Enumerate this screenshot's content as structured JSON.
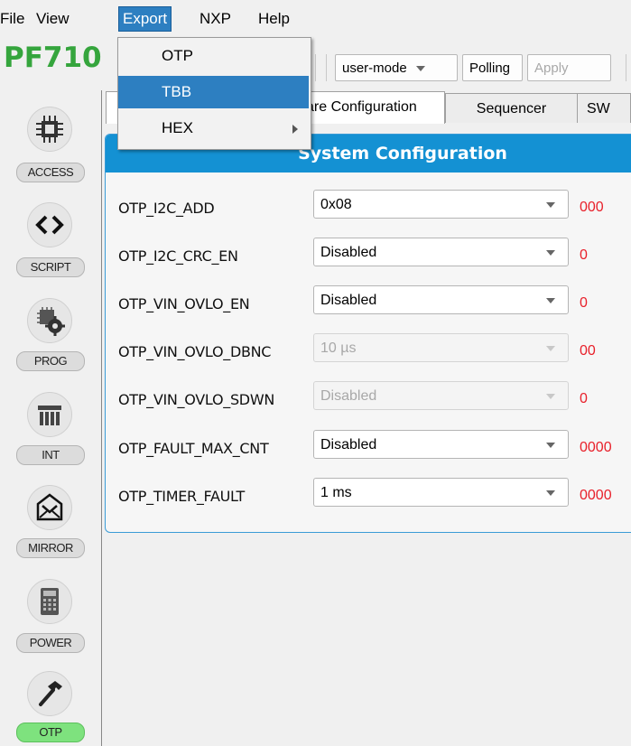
{
  "menubar": {
    "items": [
      "File",
      "View",
      "Export",
      "NXP",
      "Help"
    ]
  },
  "toolbar": {
    "brand": "PF710",
    "mode_combo": "user-mode",
    "polling_label": "Polling",
    "apply_label": "Apply"
  },
  "export_menu": {
    "items": [
      {
        "label": "OTP"
      },
      {
        "label": "TBB"
      },
      {
        "label": "HEX"
      }
    ]
  },
  "sidebar": {
    "items": [
      {
        "label": "ACCESS",
        "icon": "chip-icon"
      },
      {
        "label": "SCRIPT",
        "icon": "code-brackets-icon"
      },
      {
        "label": "PROG",
        "icon": "chip-gear-icon"
      },
      {
        "label": "INT",
        "icon": "interrupt-icon"
      },
      {
        "label": "MIRROR",
        "icon": "mirror-icon"
      },
      {
        "label": "POWER",
        "icon": "calculator-icon"
      },
      {
        "label": "OTP",
        "icon": "hammer-icon",
        "active": true
      }
    ]
  },
  "tabs": {
    "items": [
      "are Configuration",
      "Sequencer",
      "SW"
    ]
  },
  "panel": {
    "title": "System Configuration",
    "rows": [
      {
        "label": "OTP_I2C_ADD",
        "value": "0x08",
        "code": "000",
        "enabled": true
      },
      {
        "label": "OTP_I2C_CRC_EN",
        "value": "Disabled",
        "code": "0",
        "enabled": true
      },
      {
        "label": "OTP_VIN_OVLO_EN",
        "value": "Disabled",
        "code": "0",
        "enabled": true
      },
      {
        "label": "OTP_VIN_OVLO_DBNC",
        "value": "10 µs",
        "code": "00",
        "enabled": false
      },
      {
        "label": "OTP_VIN_OVLO_SDWN",
        "value": "Disabled",
        "code": "0",
        "enabled": false
      },
      {
        "label": "OTP_FAULT_MAX_CNT",
        "value": "Disabled",
        "code": "0000",
        "enabled": true
      },
      {
        "label": "OTP_TIMER_FAULT",
        "value": "1 ms",
        "code": "0000",
        "enabled": true
      }
    ]
  },
  "colors": {
    "accent_blue": "#1491d3",
    "brand_green": "#35a53d",
    "value_red": "#e8202a",
    "active_green": "#7ee27e"
  }
}
